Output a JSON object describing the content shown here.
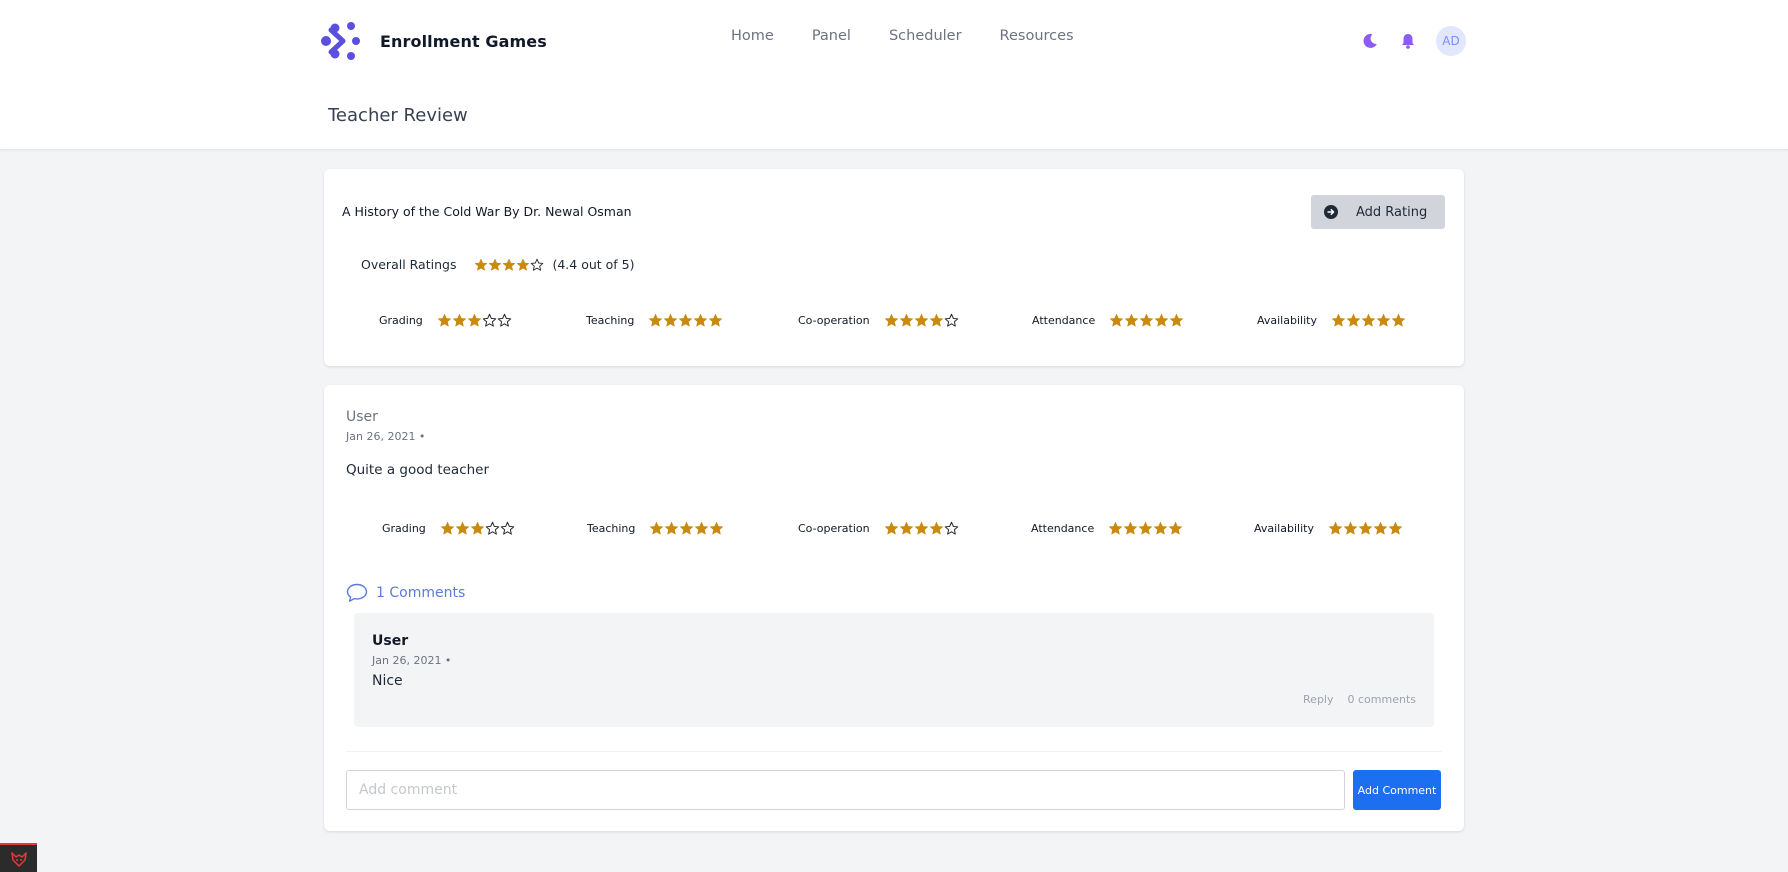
{
  "brand": {
    "name": "Enrollment Games",
    "logo_icon": "asterisk-logo-icon",
    "logo_color": "#5b4fe0"
  },
  "nav": {
    "items": [
      "Home",
      "Panel",
      "Scheduler",
      "Resources"
    ]
  },
  "header_icons": {
    "theme": "moon-icon",
    "notifications": "bell-icon",
    "accent": "#8b5cf6"
  },
  "user": {
    "initials": "AD"
  },
  "page": {
    "title": "Teacher Review"
  },
  "colors": {
    "star": "#c98a0f",
    "primary": "#1d6ff2",
    "link": "#5b7bd5"
  },
  "course": {
    "title": "A History of the Cold War By Dr. Newal Osman",
    "add_rating_label": "Add Rating",
    "overall_label": "Overall Ratings",
    "overall_stars": 4,
    "overall_text": "(4.4 out of 5)",
    "categories": [
      {
        "label": "Grading",
        "stars": 3
      },
      {
        "label": "Teaching",
        "stars": 5
      },
      {
        "label": "Co-operation",
        "stars": 4
      },
      {
        "label": "Attendance",
        "stars": 5
      },
      {
        "label": "Availability",
        "stars": 5
      }
    ]
  },
  "review": {
    "user": "User",
    "date": "Jan 26, 2021 •",
    "text": "Quite a good teacher",
    "categories": [
      {
        "label": "Grading",
        "stars": 3
      },
      {
        "label": "Teaching",
        "stars": 5
      },
      {
        "label": "Co-operation",
        "stars": 4
      },
      {
        "label": "Attendance",
        "stars": 5
      },
      {
        "label": "Availability",
        "stars": 5
      }
    ],
    "comments_label": "1 Comments",
    "comments": [
      {
        "user": "User",
        "date": "Jan 26, 2021 •",
        "text": "Nice",
        "reply_label": "Reply",
        "count_label": "0 comments"
      }
    ]
  },
  "comment_form": {
    "placeholder": "Add comment",
    "value": "",
    "button_label": "Add Comment"
  }
}
